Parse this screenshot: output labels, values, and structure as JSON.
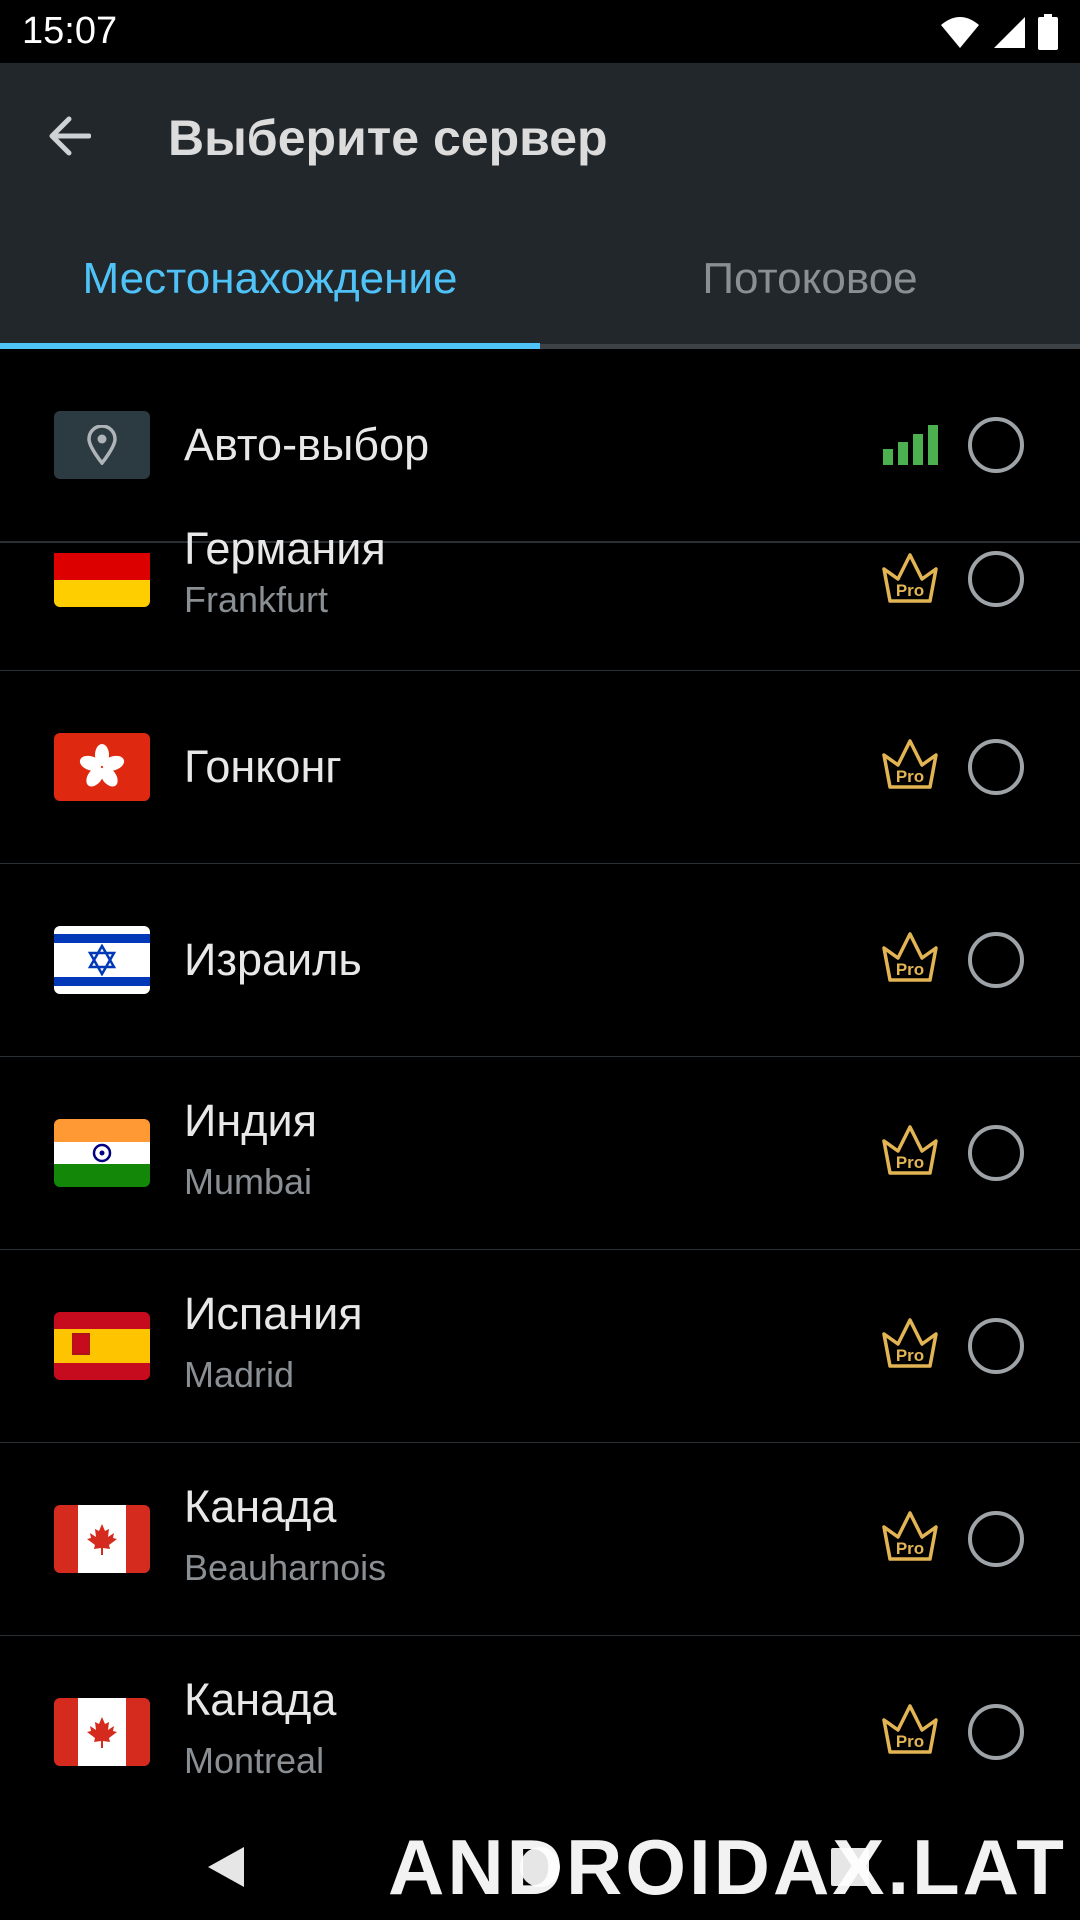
{
  "status_bar": {
    "time": "15:07"
  },
  "toolbar": {
    "title": "Выберите сервер"
  },
  "tabs": [
    {
      "label": "Местонахождение",
      "selected": true
    },
    {
      "label": "Потоковое",
      "selected": false
    }
  ],
  "auto_select": {
    "label": "Авто-выбор",
    "signal": "strong"
  },
  "servers": [
    {
      "country": "Германия",
      "city": "Frankfurt",
      "flag": "de-flag-icon"
    },
    {
      "country": "Гонконг",
      "city": "",
      "flag": "hk-flag-icon"
    },
    {
      "country": "Израиль",
      "city": "",
      "flag": "il-flag-icon"
    },
    {
      "country": "Индия",
      "city": "Mumbai",
      "flag": "in-flag-icon"
    },
    {
      "country": "Испания",
      "city": "Madrid",
      "flag": "es-flag-icon"
    },
    {
      "country": "Канада",
      "city": "Beauharnois",
      "flag": "ca-flag-icon"
    },
    {
      "country": "Канада",
      "city": "Montreal",
      "flag": "ca-flag-icon"
    }
  ],
  "pro_badge": {
    "label": "Pro"
  },
  "colors": {
    "accent": "#4fc3f7",
    "toolbar_bg": "#22272b",
    "pro_gold": "#e2b453",
    "signal_green": "#4caf50"
  },
  "watermark": {
    "text": "ANDROIDAX.LAT"
  }
}
